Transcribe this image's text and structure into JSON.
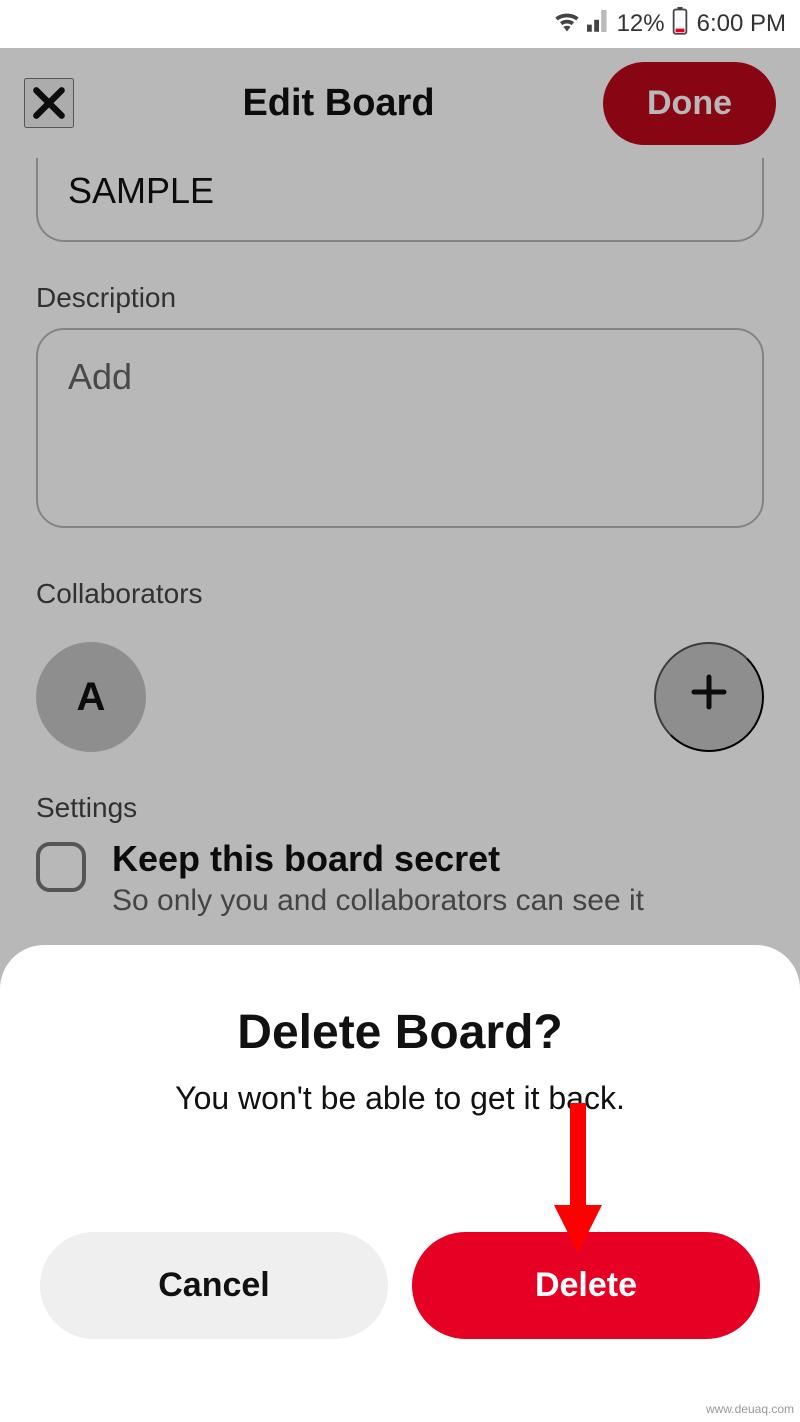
{
  "status": {
    "battery_pct": "12%",
    "time": "6:00 PM"
  },
  "header": {
    "title": "Edit Board",
    "done_label": "Done"
  },
  "board": {
    "name_value": "SAMPLE",
    "description_label": "Description",
    "description_placeholder": "Add",
    "collaborators_label": "Collaborators",
    "collaborator_initial": "A",
    "settings_label": "Settings",
    "secret_title": "Keep this board secret",
    "secret_subtitle": "So only you and collaborators can see it"
  },
  "dialog": {
    "title": "Delete Board?",
    "subtitle": "You won't be able to get it back.",
    "cancel_label": "Cancel",
    "delete_label": "Delete"
  },
  "watermark": "www.deuaq.com"
}
